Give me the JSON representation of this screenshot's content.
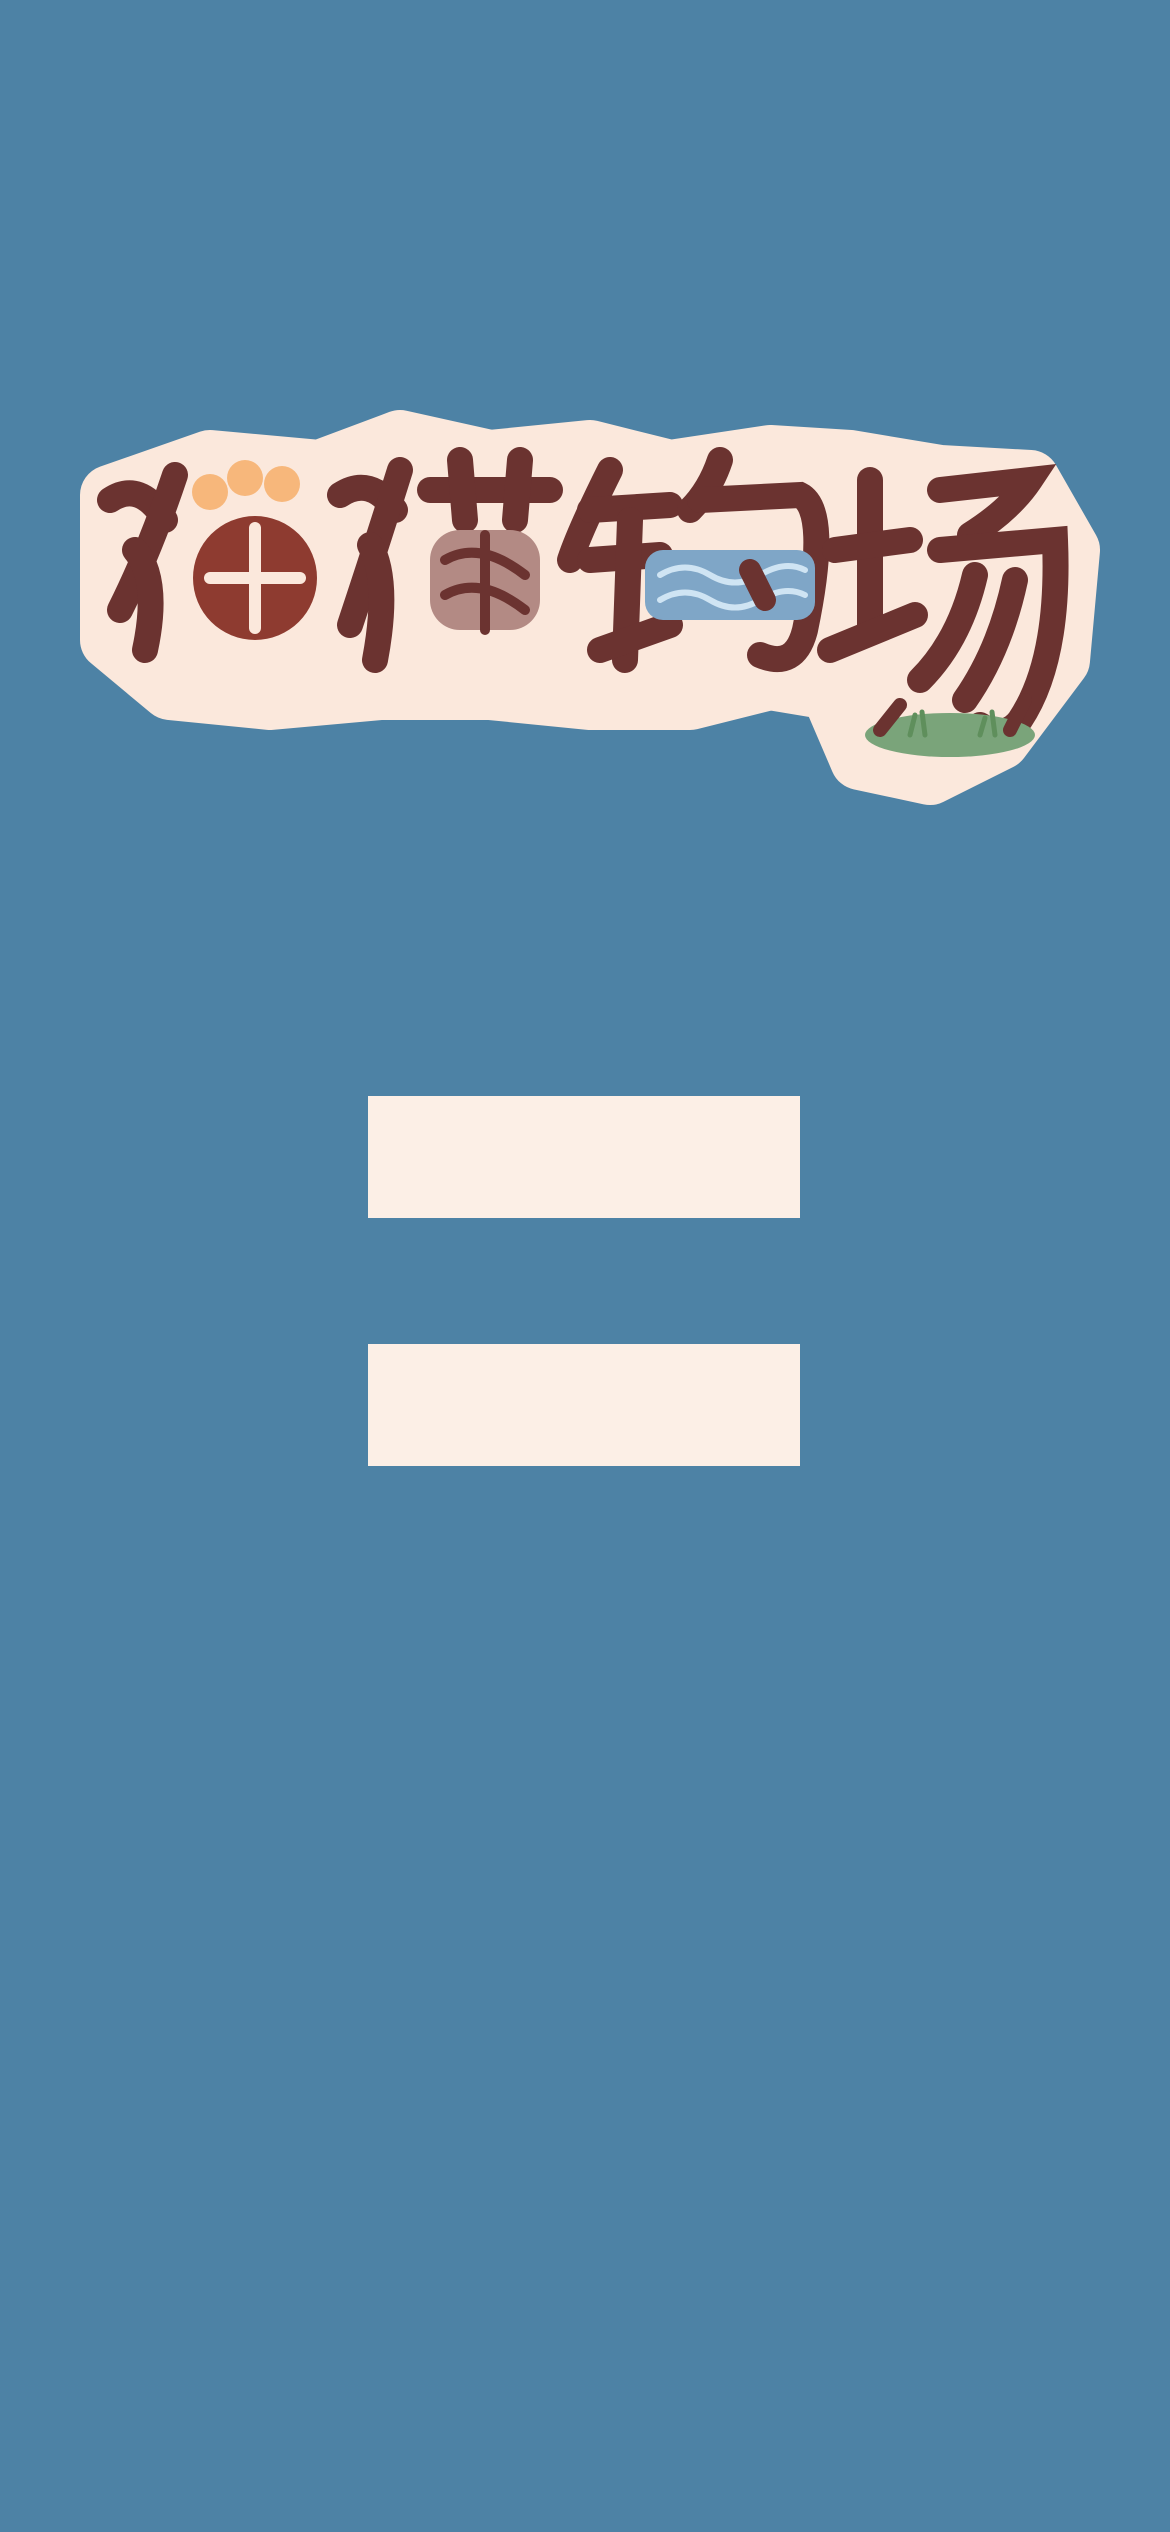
{
  "app": {
    "title": "猫猫钓场"
  },
  "menu": {
    "buttons": [
      {
        "label": ""
      },
      {
        "label": ""
      }
    ]
  },
  "colors": {
    "background": "#4d82a5",
    "button_fill": "#fcefe6",
    "logo_outline": "#fbe8dc",
    "logo_stroke": "#6b3330"
  }
}
